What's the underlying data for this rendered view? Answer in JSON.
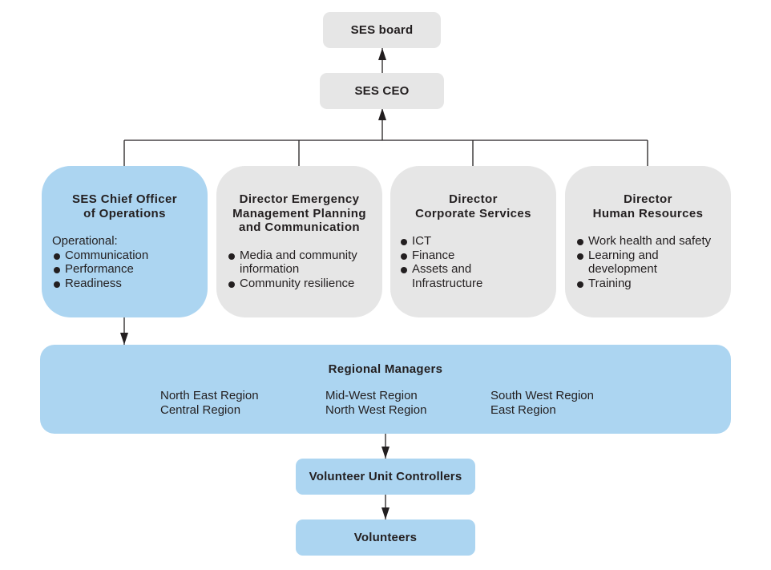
{
  "diagram": {
    "top": {
      "board": "SES board",
      "ceo": "SES CEO"
    },
    "directors": [
      {
        "title": "SES Chief Officer\nof Operations",
        "intro": "Operational:",
        "items": [
          "Communication",
          "Performance",
          "Readiness"
        ],
        "color": "#acd5f1"
      },
      {
        "title": "Director Emergency\nManagement Planning\nand Communication",
        "intro": "",
        "items": [
          "Media and community information",
          "Community resilience"
        ],
        "color": "#e6e6e6"
      },
      {
        "title": "Director\nCorporate Services",
        "intro": "",
        "items": [
          "ICT",
          "Finance",
          "Assets and Infrastructure"
        ],
        "color": "#e6e6e6"
      },
      {
        "title": "Director\nHuman Resources",
        "intro": "",
        "items": [
          "Work health and safety",
          "Learning and development",
          "Training"
        ],
        "color": "#e6e6e6"
      }
    ],
    "regional": {
      "title": "Regional Managers",
      "columns": [
        [
          "North East Region",
          "Central Region"
        ],
        [
          "Mid-West Region",
          "North West Region"
        ],
        [
          "South West Region",
          "East Region"
        ]
      ]
    },
    "unit_controllers": "Volunteer Unit Controllers",
    "volunteers": "Volunteers",
    "colors": {
      "blue": "#acd5f1",
      "gray": "#e6e6e6",
      "line": "#231f20"
    }
  }
}
